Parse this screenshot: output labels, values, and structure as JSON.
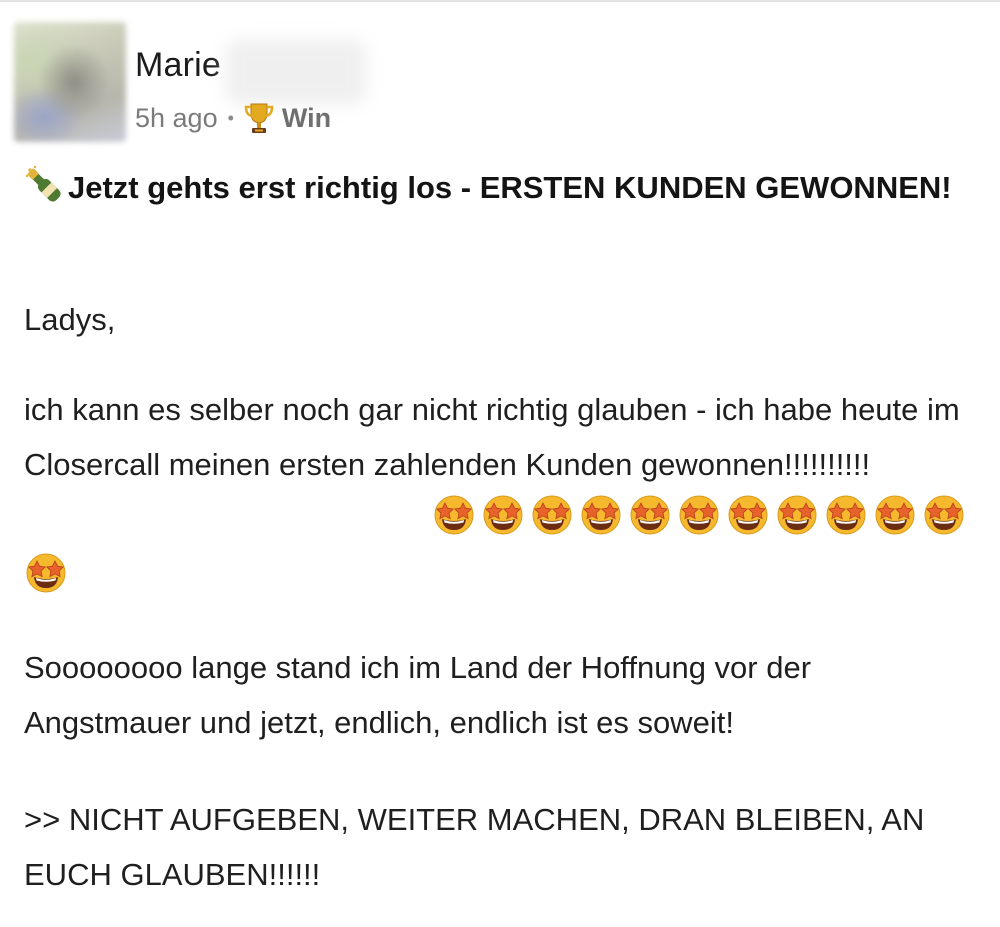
{
  "post": {
    "author": {
      "name": "Marie"
    },
    "meta": {
      "time": "5h ago",
      "separator": "•",
      "badge_icon": "trophy-icon",
      "badge_label": "Win"
    },
    "title": {
      "icon": "champagne-bottle-icon",
      "text": "Jetzt gehts erst richtig los - ERSTEN KUNDEN GEWONNEN!"
    },
    "body": {
      "p1": "Ladys,",
      "p2": "ich kann es selber noch gar nicht richtig glauben - ich habe heute im Closercall meinen ersten zahlenden Kunden gewonnen!!!!!!!!!!",
      "p2_emoji": "star-struck-emoji",
      "p2_emoji_count": 12,
      "p3": "Soooooooo lange stand ich im Land der Hoffnung vor der Angstmauer und jetzt, endlich, endlich ist es soweit!",
      "p4": ">> NICHT AUFGEBEN, WEITER MACHEN, DRAN BLEIBEN, AN EUCH GLAUBEN!!!!!!"
    }
  },
  "colors": {
    "text": "#1f1f1f",
    "meta_text": "#7b7b7b",
    "emoji_face": "#f6b92e",
    "emoji_star": "#e8622c"
  }
}
